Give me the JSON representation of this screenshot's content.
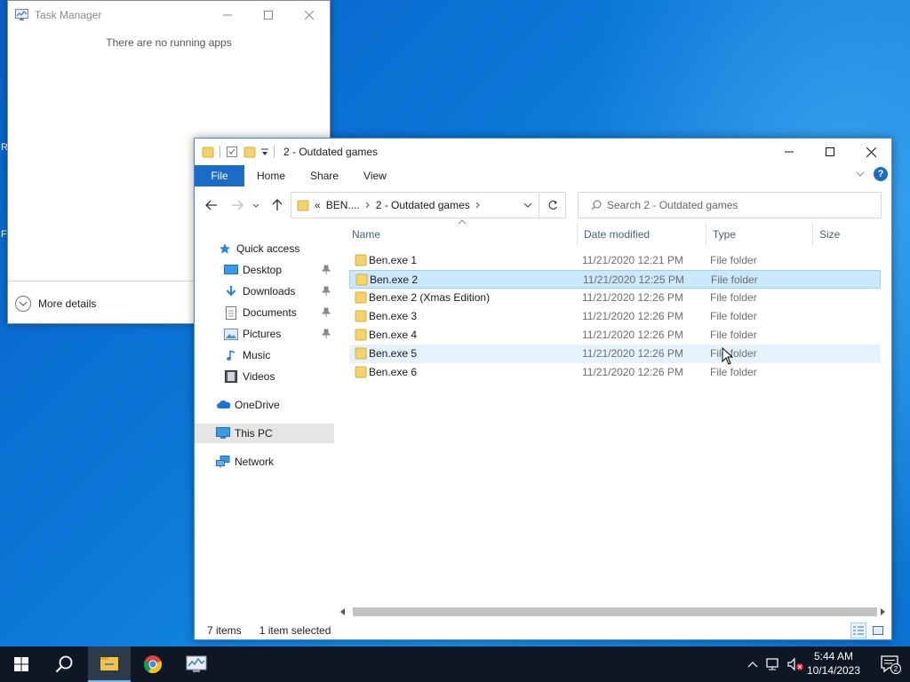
{
  "task_manager": {
    "title": "Task Manager",
    "empty_message": "There are no running apps",
    "more_details_label": "More details"
  },
  "explorer": {
    "title": "2 - Outdated games",
    "ribbon_tabs": [
      "File",
      "Home",
      "Share",
      "View"
    ],
    "address": {
      "overflow": "«",
      "crumbs": [
        "BEN....",
        "2 - Outdated games"
      ]
    },
    "search_placeholder": "Search 2 - Outdated games",
    "nav_pane": {
      "quick_access": "Quick access",
      "pinned": [
        "Desktop",
        "Downloads",
        "Documents",
        "Pictures"
      ],
      "unpinned": [
        "Music",
        "Videos"
      ],
      "onedrive": "OneDrive",
      "this_pc": "This PC",
      "network": "Network"
    },
    "columns": [
      "Name",
      "Date modified",
      "Type",
      "Size"
    ],
    "rows": [
      {
        "name": "Ben.exe 1",
        "date": "11/21/2020 12:21 PM",
        "type": "File folder"
      },
      {
        "name": "Ben.exe 2",
        "date": "11/21/2020 12:25 PM",
        "type": "File folder",
        "state": "selected"
      },
      {
        "name": "Ben.exe 2 (Xmas Edition)",
        "date": "11/21/2020 12:26 PM",
        "type": "File folder"
      },
      {
        "name": "Ben.exe 3",
        "date": "11/21/2020 12:26 PM",
        "type": "File folder"
      },
      {
        "name": "Ben.exe 4",
        "date": "11/21/2020 12:26 PM",
        "type": "File folder"
      },
      {
        "name": "Ben.exe 5",
        "date": "11/21/2020 12:26 PM",
        "type": "File folder",
        "state": "hover"
      },
      {
        "name": "Ben.exe 6",
        "date": "11/21/2020 12:26 PM",
        "type": "File folder"
      }
    ],
    "status": {
      "item_count": "7 items",
      "selection": "1 item selected"
    }
  },
  "taskbar": {
    "time": "5:44 AM",
    "date": "10/14/2023",
    "notification_count": "2",
    "apps": [
      "start-icon",
      "search-icon",
      "file-explorer-icon",
      "chrome-icon",
      "task-manager-icon"
    ]
  },
  "colors": {
    "accent": "#1a6cc4",
    "selection_bg": "#cce8ff",
    "hover_bg": "#e5f3ff",
    "folder": "#f5d36b",
    "taskbar": "#0e1724"
  }
}
